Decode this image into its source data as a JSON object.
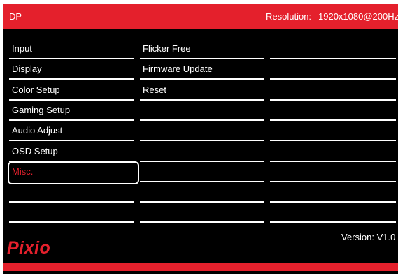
{
  "header": {
    "input_source": "DP",
    "resolution_label": "Resolution:",
    "resolution_value": "1920x1080@200Hz"
  },
  "main_menu": {
    "items": [
      "Input",
      "Display",
      "Color Setup",
      "Gaming Setup",
      "Audio Adjust",
      "OSD Setup",
      "Misc.",
      "",
      ""
    ],
    "selected": "Misc."
  },
  "submenu": {
    "items": [
      "Flicker Free",
      "Firmware Update",
      "Reset",
      "",
      "",
      "",
      "",
      "",
      ""
    ]
  },
  "footer": {
    "version": "Version: V1.0",
    "brand": "Pixio"
  },
  "colors": {
    "accent": "#e4202c",
    "background": "#000000",
    "text": "#ffffff"
  }
}
